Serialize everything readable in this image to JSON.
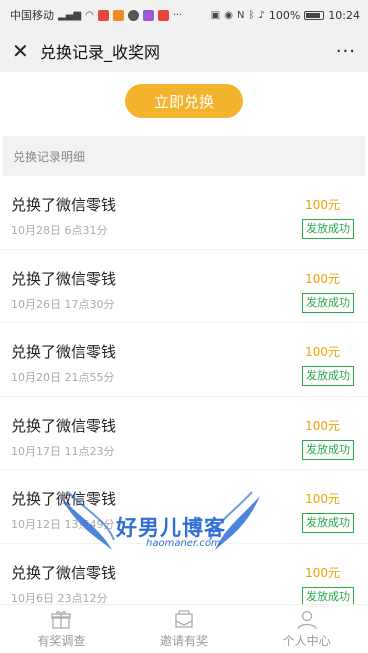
{
  "status_bar": {
    "carrier": "中国移动",
    "battery": "100%",
    "time": "10:24"
  },
  "header": {
    "title": "兑换记录_收奖网",
    "close_icon": "close-icon",
    "more_icon": "more-icon"
  },
  "redeem_button_label": "立即兑换",
  "section_title": "兑换记录明细",
  "records": [
    {
      "title": "兑换了微信零钱",
      "time": "10月28日 6点31分",
      "amount": "100元",
      "status": "发放成功"
    },
    {
      "title": "兑换了微信零钱",
      "time": "10月26日 17点30分",
      "amount": "100元",
      "status": "发放成功"
    },
    {
      "title": "兑换了微信零钱",
      "time": "10月20日 21点55分",
      "amount": "100元",
      "status": "发放成功"
    },
    {
      "title": "兑换了微信零钱",
      "time": "10月17日 11点23分",
      "amount": "100元",
      "status": "发放成功"
    },
    {
      "title": "兑换了微信零钱",
      "time": "10月12日 13点49分",
      "amount": "100元",
      "status": "发放成功"
    },
    {
      "title": "兑换了微信零钱",
      "time": "10月6日 23点12分",
      "amount": "100元",
      "status": "发放成功"
    }
  ],
  "tabs": [
    {
      "label": "有奖调查",
      "icon": "gift-icon"
    },
    {
      "label": "邀请有奖",
      "icon": "envelope-icon"
    },
    {
      "label": "个人中心",
      "icon": "user-icon"
    }
  ],
  "watermark": {
    "text": "好男儿博客",
    "sub": "haomaner.com"
  },
  "colors": {
    "accent": "#f3b32c",
    "amount": "#f2a100",
    "success": "#29a84a",
    "watermark": "#2f6fd6"
  }
}
